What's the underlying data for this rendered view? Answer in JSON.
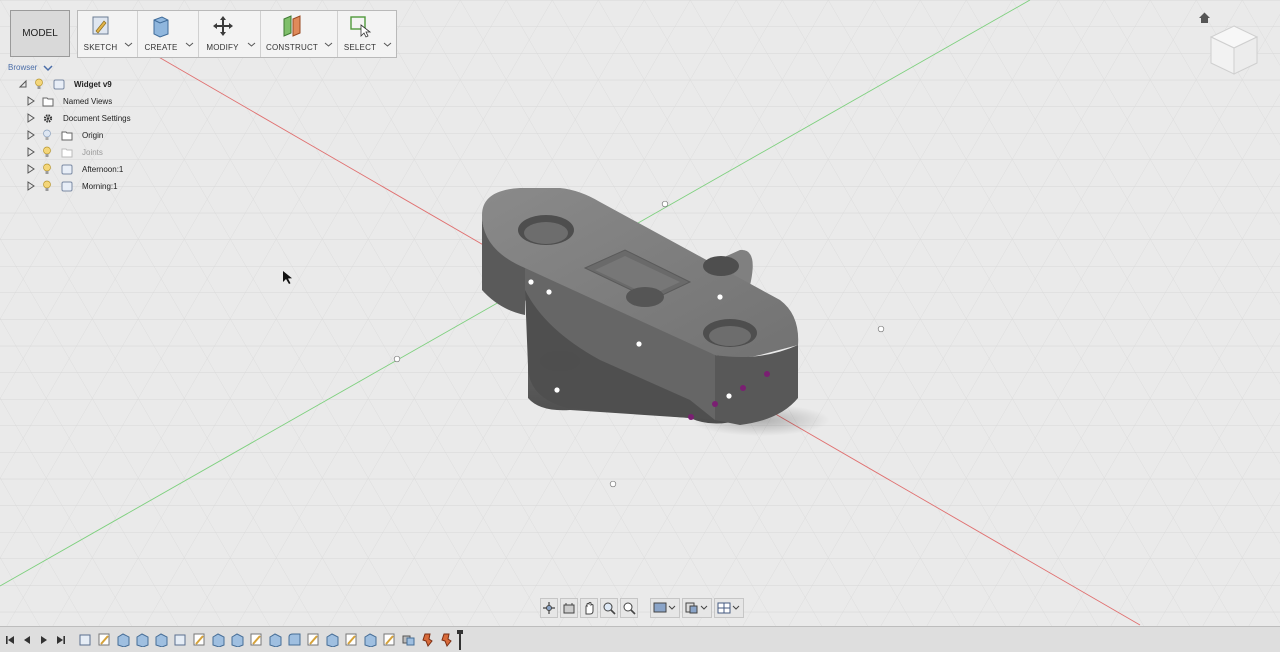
{
  "toolbar": {
    "workspace_label": "MODEL",
    "tools": [
      {
        "label": "SKETCH",
        "icon": "sketch-icon"
      },
      {
        "label": "CREATE",
        "icon": "create-icon"
      },
      {
        "label": "MODIFY",
        "icon": "modify-icon"
      },
      {
        "label": "CONSTRUCT",
        "icon": "construct-icon"
      },
      {
        "label": "SELECT",
        "icon": "select-icon"
      }
    ]
  },
  "browser": {
    "title": "Browser",
    "items": [
      {
        "label": "Widget v9",
        "icon": "component-icon"
      },
      {
        "label": "Named Views",
        "icon": "folder-icon"
      },
      {
        "label": "Document Settings",
        "icon": "gear-icon"
      },
      {
        "label": "Origin",
        "icon": "folder-icon"
      },
      {
        "label": "Joints",
        "icon": "folder-icon"
      },
      {
        "label": "Afternoon:1",
        "icon": "component-icon"
      },
      {
        "label": "Morning:1",
        "icon": "component-icon"
      }
    ]
  },
  "navigation_bar": [
    "orbit-icon",
    "look-at-icon",
    "pan-icon",
    "zoom-icon",
    "fit-icon",
    "display-settings-icon",
    "visual-style-icon",
    "grid-settings-icon"
  ],
  "timeline": {
    "controls": [
      "go-to-start-icon",
      "previous-step-icon",
      "play-icon",
      "go-to-end-icon"
    ],
    "features": [
      "box",
      "sketch",
      "extrude",
      "extrude",
      "extrude",
      "box",
      "sketch",
      "extrude",
      "extrude",
      "sketch",
      "extrude",
      "fillet",
      "sketch",
      "extrude",
      "sketch",
      "extrude",
      "sketch",
      "combine",
      "joint",
      "joint"
    ]
  },
  "colors": {
    "model": "#6b6b6b",
    "x_axis": "#e06a6a",
    "y_axis": "#78d078",
    "grid": "#d9d9d9",
    "accent": "#4a6da8",
    "joint_point": "#7a1f72"
  }
}
